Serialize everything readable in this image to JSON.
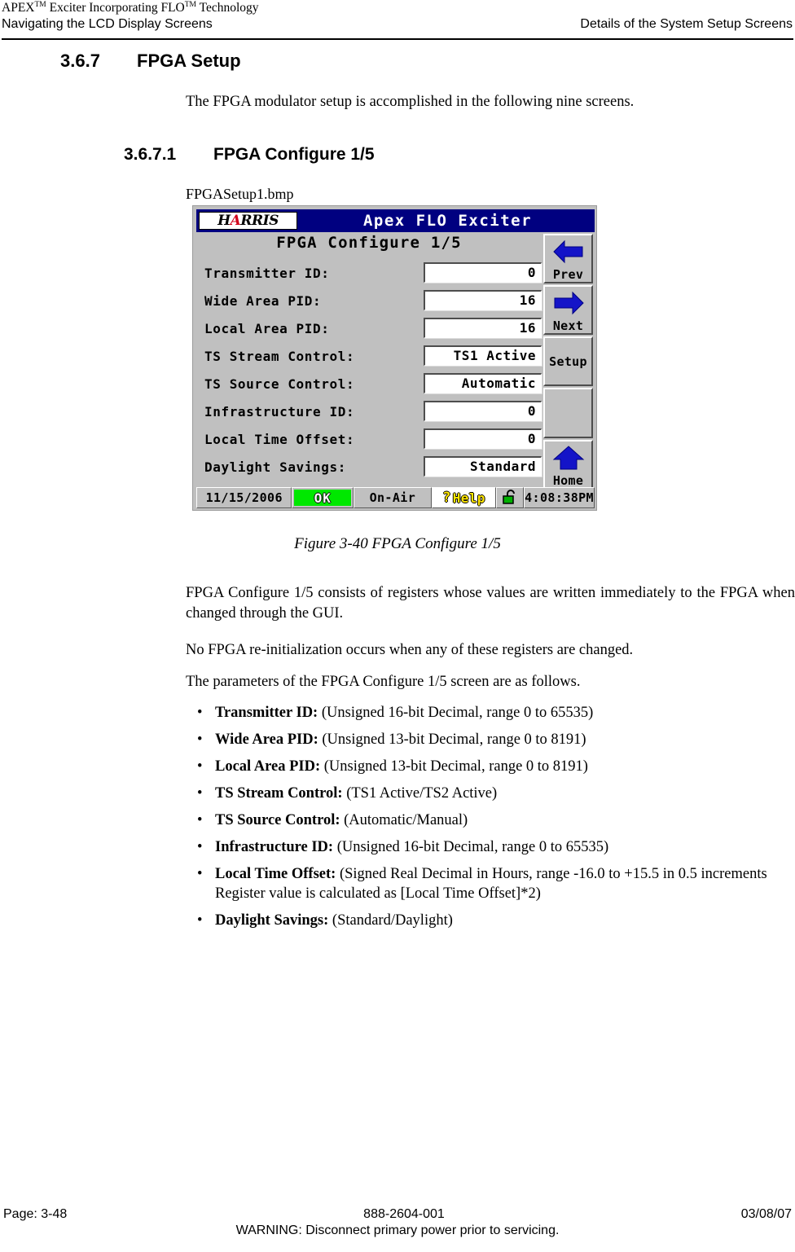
{
  "header": {
    "product_line_pre": "APEX",
    "product_line_tm1": "TM",
    "product_line_mid": " Exciter Incorporating FLO",
    "product_line_tm2": "TM",
    "product_line_post": " Technology",
    "left": "Navigating the LCD Display Screens",
    "right": "Details of the System Setup Screens"
  },
  "section": {
    "number": "3.6.7",
    "title": "FPGA Setup",
    "intro": "The FPGA modulator setup is accomplished in the following nine screens.",
    "sub_number": "3.6.7.1",
    "sub_title": "FPGA Configure 1/5",
    "bmp_name": "FPGASetup1.bmp"
  },
  "lcd": {
    "logo": {
      "pre": "H",
      "accent": "A",
      "post": "RRIS"
    },
    "app_title": "Apex FLO Exciter",
    "screen_heading": "FPGA Configure 1/5",
    "rows": [
      {
        "label": "Transmitter ID:",
        "value": "0"
      },
      {
        "label": "Wide Area PID:",
        "value": "16"
      },
      {
        "label": "Local Area PID:",
        "value": "16"
      },
      {
        "label": "TS Stream Control:",
        "value": "TS1 Active"
      },
      {
        "label": "TS Source Control:",
        "value": "Automatic"
      },
      {
        "label": "Infrastructure ID:",
        "value": "0"
      },
      {
        "label": "Local Time Offset:",
        "value": "0"
      },
      {
        "label": "Daylight Savings:",
        "value": "Standard"
      }
    ],
    "buttons": [
      {
        "label": "Prev",
        "icon": "arrow-left-icon"
      },
      {
        "label": "Next",
        "icon": "arrow-right-icon"
      },
      {
        "label": "Setup",
        "icon": "none"
      },
      {
        "label": "",
        "icon": "none"
      },
      {
        "label": "Home",
        "icon": "house-icon"
      }
    ],
    "status": {
      "date": "11/15/2006",
      "state": "OK",
      "air": "On-Air",
      "help_mark": "?",
      "help": "Help",
      "lock_icon": "padlock-open-icon",
      "time": "4:08:38PM"
    },
    "colors": {
      "titlebar": "#000080",
      "panel": "#c0c0c0",
      "ok_green": "#00e800",
      "arrow_blue": "#1414c8",
      "help_yellow": "#ffe600",
      "logo_red": "#d0021b"
    }
  },
  "figure": {
    "caption": "Figure 3-40  FPGA Configure 1/5"
  },
  "body": {
    "p1": "FPGA Configure 1/5 consists of registers whose values are written immediately to the FPGA when changed through the GUI.",
    "p2": "No FPGA re-initialization occurs when any of these registers are changed.",
    "p3": "The parameters of the FPGA Configure 1/5 screen are as follows."
  },
  "parameters": [
    {
      "term": "Transmitter ID:",
      "desc": "(Unsigned 16-bit Decimal, range 0 to 65535)"
    },
    {
      "term": "Wide Area PID:",
      "desc": "(Unsigned 13-bit Decimal, range 0 to 8191)"
    },
    {
      "term": "Local Area PID:",
      "desc": "(Unsigned 13-bit Decimal, range 0 to 8191)"
    },
    {
      "term": "TS Stream Control:",
      "desc": "(TS1 Active/TS2 Active)"
    },
    {
      "term": "TS Source Control:",
      "desc": "(Automatic/Manual)"
    },
    {
      "term": "Infrastructure ID:",
      "desc": "(Unsigned 16-bit Decimal, range 0 to 65535)"
    },
    {
      "term": "Local Time Offset:",
      "desc": "(Signed Real Decimal in Hours, range -16.0 to +15.5 in 0.5 increments  Register value is calculated as [Local Time Offset]*2)"
    },
    {
      "term": "Daylight Savings:",
      "desc": "(Standard/Daylight)"
    }
  ],
  "footer": {
    "page": "Page: 3-48",
    "doc_number": "888-2604-001",
    "date": "03/08/07",
    "warning": "WARNING: Disconnect primary power prior to servicing."
  },
  "bullet_char": "•"
}
